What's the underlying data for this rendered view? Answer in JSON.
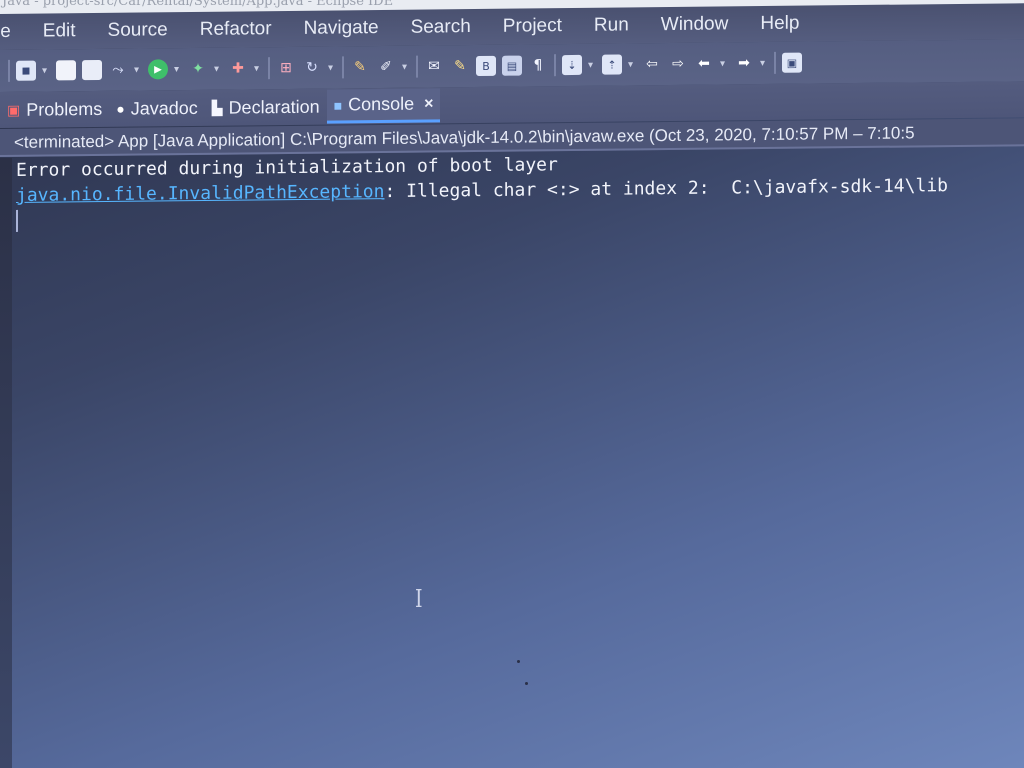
{
  "window": {
    "title": "Java - project-src/Car/Rental/System/App.java - Eclipse IDE"
  },
  "menubar": {
    "items": [
      "le",
      "Edit",
      "Source",
      "Refactor",
      "Navigate",
      "Search",
      "Project",
      "Run",
      "Window",
      "Help"
    ]
  },
  "toolbar": {
    "icons": [
      "new-icon",
      "save-icon",
      "save-all-icon",
      "skip-breakpoints-icon",
      "run-icon",
      "debug-icon",
      "coverage-icon",
      "external-tools-icon",
      "new-java-project-icon",
      "new-package-icon",
      "new-class-icon",
      "open-type-icon",
      "search-icon",
      "toggle-mark-occurrences-icon",
      "show-whitespace-icon",
      "next-annotation-icon",
      "previous-annotation-icon",
      "back-icon",
      "forward-icon",
      "pin-editor-icon"
    ]
  },
  "tabs": [
    {
      "label": "Problems",
      "icon": "problems-icon",
      "active": false
    },
    {
      "label": "Javadoc",
      "icon": "javadoc-icon",
      "active": false
    },
    {
      "label": "Declaration",
      "icon": "declaration-icon",
      "active": false
    },
    {
      "label": "Console",
      "icon": "console-icon",
      "active": true,
      "close": "×"
    }
  ],
  "console": {
    "status": "<terminated> App [Java Application] C:\\Program Files\\Java\\jdk-14.0.2\\bin\\javaw.exe  (Oct 23, 2020, 7:10:57 PM – 7:10:5",
    "line1": "Error occurred during initialization of boot layer",
    "exception_link": "java.nio.file.InvalidPathException",
    "exception_msg": ": Illegal char <:> at index 2:  C:\\javafx-sdk-14\\lib"
  },
  "colors": {
    "link": "#57b6ff",
    "active_tab_underline": "#5aa0ff"
  }
}
